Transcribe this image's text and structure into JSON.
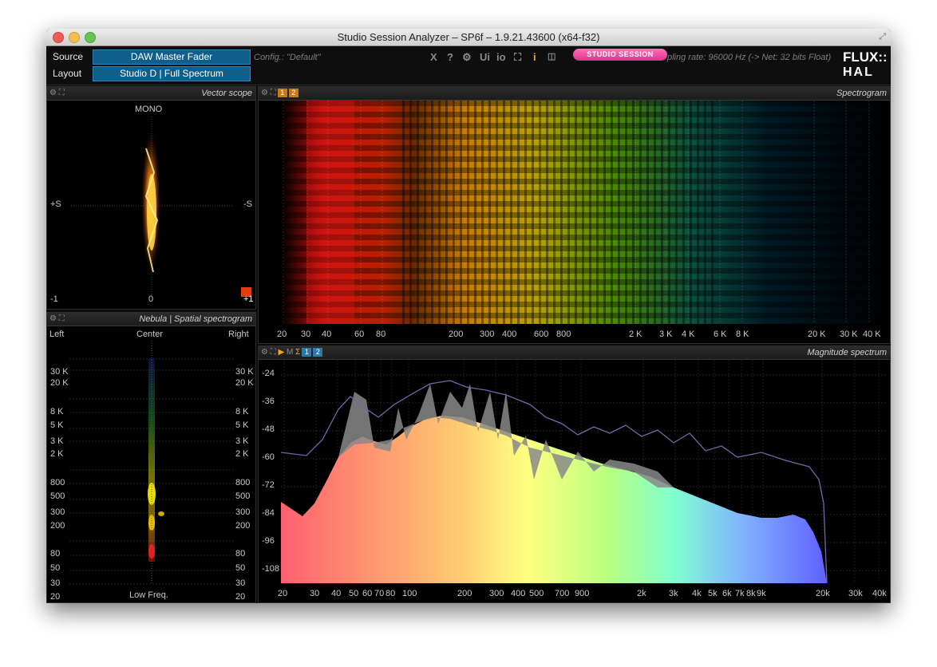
{
  "window": {
    "title": "Studio Session Analyzer – SP6f – 1.9.21.43600 (x64-f32)"
  },
  "toolbar": {
    "source_label": "Source",
    "source_value": "DAW Master Fader",
    "layout_label": "Layout",
    "layout_value": "Studio D | Full Spectrum",
    "config": "Config.: \"Default\"",
    "icons": [
      "X",
      "?",
      "⚙",
      "Ui",
      "io",
      "⛶",
      "i",
      "◫"
    ],
    "badge": "STUDIO SESSION",
    "rate": "pling rate: 96000 Hz (-> Net: 32 bits Float)",
    "logo_top": "FLUX::",
    "logo_bottom": "HAL"
  },
  "vector_scope": {
    "title": "Vector scope",
    "mono": "MONO",
    "plus_s": "+S",
    "minus_s": "-S",
    "minus_one": "-1",
    "zero": "0",
    "plus_one": "+1"
  },
  "nebula": {
    "title": "Nebula | Spatial spectrogram",
    "left": "Left",
    "center": "Center",
    "right": "Right",
    "low_freq": "Low Freq.",
    "freq_labels": [
      "30 K",
      "20 K",
      "8 K",
      "5 K",
      "3 K",
      "2 K",
      "800",
      "500",
      "300",
      "200",
      "80",
      "50",
      "30",
      "20"
    ]
  },
  "spectrogram": {
    "title": "Spectrogram",
    "tag1": "1",
    "tag2": "2",
    "x_labels": [
      "20",
      "30",
      "40",
      "60",
      "80",
      "200",
      "300",
      "400",
      "600",
      "800",
      "2 K",
      "3 K",
      "4 K",
      "6 K",
      "8 K",
      "20 K",
      "30 K",
      "40 K"
    ]
  },
  "magnitude": {
    "title": "Magnitude spectrum",
    "tag1": "1",
    "tag2": "2",
    "y_labels": [
      "-24",
      "-36",
      "-48",
      "-60",
      "-72",
      "-84",
      "-96",
      "-108"
    ],
    "x_labels": [
      "20",
      "30",
      "40",
      "50",
      "60",
      "70",
      "80",
      "100",
      "200",
      "300",
      "400",
      "500",
      "700",
      "900",
      "2k",
      "3k",
      "4k",
      "5k",
      "6k",
      "7k",
      "8k",
      "9k",
      "20k",
      "30k",
      "40k"
    ]
  },
  "colors": {
    "accent": "#0f5f8a",
    "badge": "#e0338d",
    "panel_bg": "#000000"
  }
}
